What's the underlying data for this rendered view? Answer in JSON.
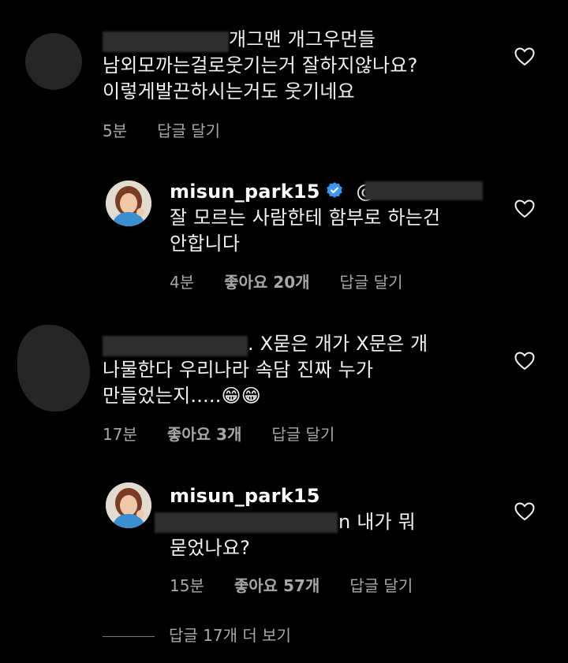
{
  "comments": [
    {
      "lines": [
        "개그맨 개그우먼들",
        "남외모까는걸로웃기는거 잘하지않나요?",
        "이렇게발끈하시는거도 웃기네요"
      ],
      "time": "5분",
      "reply": "답글 달기"
    },
    {
      "username": "misun_park15",
      "mention_prefix": "@",
      "lines": [
        "잘 모르는 사람한테  함부로 하는건",
        "안합니다"
      ],
      "time": "4분",
      "likes": "좋아요 20개",
      "reply": "답글 달기"
    },
    {
      "lines": [
        ". X묻은 개가 X문은 개",
        "나물한다 우리나라 속담 진짜 누가",
        "만들었는지....."
      ],
      "emoji": "😁😁",
      "time": "17분",
      "likes": "좋아요 3개",
      "reply": "답글 달기"
    },
    {
      "username": "misun_park15",
      "lines": [
        "n 내가  뭐",
        "묻었나요?"
      ],
      "time": "15분",
      "likes": "좋아요 57개",
      "reply": "답글 달기"
    }
  ],
  "view_more": "답글 17개 더 보기",
  "icons": {
    "like": "heart-outline-icon",
    "verified": "verified-badge-icon"
  },
  "colors": {
    "verified": "#3897f0",
    "meta": "#a8a8a8"
  }
}
